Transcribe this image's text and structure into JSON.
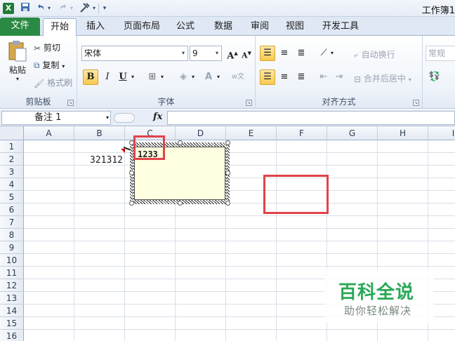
{
  "window": {
    "title": "工作簿1"
  },
  "qat": {
    "logo": "X",
    "save_icon": "save-icon",
    "undo_icon": "undo-icon",
    "redo_icon": "redo-icon",
    "custom_icon": "tools-icon"
  },
  "tabs": [
    {
      "label": "文件"
    },
    {
      "label": "开始"
    },
    {
      "label": "插入"
    },
    {
      "label": "页面布局"
    },
    {
      "label": "公式"
    },
    {
      "label": "数据"
    },
    {
      "label": "审阅"
    },
    {
      "label": "视图"
    },
    {
      "label": "开发工具"
    }
  ],
  "ribbon": {
    "clipboard": {
      "paste": "粘贴",
      "cut": "剪切",
      "copy": "复制",
      "format_painter": "格式刷",
      "label": "剪贴板"
    },
    "font": {
      "name": "宋体",
      "size": "9",
      "bold": "B",
      "italic": "I",
      "underline": "U",
      "label": "字体"
    },
    "alignment": {
      "wrap": "自动换行",
      "merge": "合并后居中",
      "label": "对齐方式"
    },
    "number": {
      "format": "常规"
    }
  },
  "formula_bar": {
    "name_box": "备注 1",
    "fx": "fx",
    "content": ""
  },
  "grid": {
    "columns": [
      "A",
      "B",
      "C",
      "D",
      "E",
      "F",
      "G",
      "H",
      "I"
    ],
    "rows": [
      "1",
      "2",
      "3",
      "4",
      "5",
      "6",
      "7",
      "8",
      "9",
      "10",
      "11",
      "12",
      "13",
      "14",
      "15",
      "16"
    ],
    "cell_B2": "321312",
    "comment_text": "1233"
  },
  "watermark": {
    "line1": "百科全说",
    "line2": "助你轻松解决"
  }
}
